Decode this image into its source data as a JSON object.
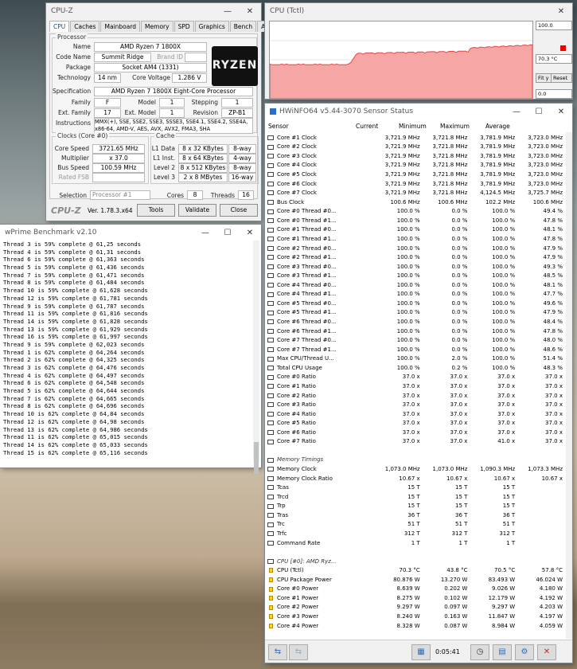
{
  "cpuz": {
    "title": "CPU-Z",
    "tabs": [
      "CPU",
      "Caches",
      "Mainboard",
      "Memory",
      "SPD",
      "Graphics",
      "Bench",
      "About"
    ],
    "processor_group": "Processor",
    "name_label": "Name",
    "name": "AMD Ryzen 7 1800X",
    "codename_label": "Code Name",
    "codename": "Summit Ridge",
    "brandid_label": "Brand ID",
    "package_label": "Package",
    "package": "Socket AM4 (1331)",
    "technology_label": "Technology",
    "technology": "14 nm",
    "voltage_label": "Core Voltage",
    "voltage": "1.286 V",
    "spec_label": "Specification",
    "spec": "AMD Ryzen 7 1800X Eight-Core Processor",
    "family_label": "Family",
    "family": "F",
    "model_label": "Model",
    "model": "1",
    "stepping_label": "Stepping",
    "stepping": "1",
    "extfamily_label": "Ext. Family",
    "extfamily": "17",
    "extmodel_label": "Ext. Model",
    "extmodel": "1",
    "revision_label": "Revision",
    "revision": "ZP-B1",
    "instructions_label": "Instructions",
    "instructions": "MMX(+), SSE, SSE2, SSE3, SSSE3, SSE4.1, SSE4.2, SSE4A, x86-64, AMD-V, AES, AVX, AVX2, FMA3, SHA",
    "clocks_group": "Clocks (Core #0)",
    "cache_group": "Cache",
    "corespeed_label": "Core Speed",
    "corespeed": "3721.65 MHz",
    "multiplier_label": "Multiplier",
    "multiplier": "x 37.0",
    "busspeed_label": "Bus Speed",
    "busspeed": "100.59 MHz",
    "ratedfsb_label": "Rated FSB",
    "l1d_label": "L1 Data",
    "l1d": "8 x 32 KBytes",
    "l1d_way": "8-way",
    "l1i_label": "L1 Inst.",
    "l1i": "8 x 64 KBytes",
    "l1i_way": "4-way",
    "l2_label": "Level 2",
    "l2": "8 x 512 KBytes",
    "l2_way": "8-way",
    "l3_label": "Level 3",
    "l3": "2 x 8 MBytes",
    "l3_way": "16-way",
    "selection_label": "Selection",
    "selection": "Processor #1",
    "cores_label": "Cores",
    "cores": "8",
    "threads_label": "Threads",
    "threads": "16",
    "brand": "CPU-Z",
    "version": "Ver. 1.78.3.x64",
    "tools": "Tools",
    "validate": "Validate",
    "close": "Close",
    "logo_text": "RYZEN"
  },
  "graph": {
    "title": "CPU (Tctl)",
    "top": "100.0",
    "current": "70.3 °C",
    "bottom": "0.0",
    "fit": "Fit y",
    "reset": "Reset",
    "line_color": "#e84545"
  },
  "wprime": {
    "title": "wPrime Benchmark v2.10",
    "lines": [
      "Thread 3 is 59% complete @ 61,25 seconds",
      "Thread 4 is 59% complete @ 61,31 seconds",
      "Thread 6 is 59% complete @ 61,363 seconds",
      "Thread 5 is 59% complete @ 61,436 seconds",
      "Thread 7 is 59% complete @ 61,471 seconds",
      "Thread 8 is 59% complete @ 61,484 seconds",
      "Thread 10 is 59% complete @ 61,628 seconds",
      "Thread 12 is 59% complete @ 61,781 seconds",
      "Thread 9 is 59% complete @ 61,787 seconds",
      "Thread 11 is 59% complete @ 61,816 seconds",
      "Thread 14 is 59% complete @ 61,828 seconds",
      "Thread 13 is 59% complete @ 61,929 seconds",
      "Thread 16 is 59% complete @ 61,997 seconds",
      "Thread 9 is 59% complete @ 62,023 seconds",
      "Thread 1 is 62% complete @ 64,264 seconds",
      "Thread 2 is 62% complete @ 64,325 seconds",
      "Thread 3 is 62% complete @ 64,476 seconds",
      "Thread 4 is 62% complete @ 64,497 seconds",
      "Thread 6 is 62% complete @ 64,548 seconds",
      "Thread 5 is 62% complete @ 64,644 seconds",
      "Thread 7 is 62% complete @ 64,665 seconds",
      "Thread 8 is 62% complete @ 64,696 seconds",
      "Thread 10 is 62% complete @ 64,84 seconds",
      "Thread 12 is 62% complete @ 64,98 seconds",
      "Thread 13 is 62% complete @ 64,986 seconds",
      "Thread 11 is 62% complete @ 65,015 seconds",
      "Thread 14 is 62% complete @ 65,033 seconds",
      "Thread 15 is 62% complete @ 65,116 seconds"
    ]
  },
  "hw": {
    "title": "HWiNFO64 v5.44-3070 Sensor Status",
    "cols": [
      "Sensor",
      "Current",
      "Minimum",
      "Maximum",
      "Average"
    ],
    "rows": [
      {
        "t": "c",
        "n": "Core #1 Clock",
        "v": [
          "3,721.9 MHz",
          "3,721.8 MHz",
          "3,781.9 MHz",
          "3,723.0 MHz"
        ]
      },
      {
        "t": "c",
        "n": "Core #2 Clock",
        "v": [
          "3,721.9 MHz",
          "3,721.8 MHz",
          "3,781.9 MHz",
          "3,723.0 MHz"
        ]
      },
      {
        "t": "c",
        "n": "Core #3 Clock",
        "v": [
          "3,721.9 MHz",
          "3,721.8 MHz",
          "3,781.9 MHz",
          "3,723.0 MHz"
        ]
      },
      {
        "t": "c",
        "n": "Core #4 Clock",
        "v": [
          "3,721.9 MHz",
          "3,721.8 MHz",
          "3,781.9 MHz",
          "3,723.0 MHz"
        ]
      },
      {
        "t": "c",
        "n": "Core #5 Clock",
        "v": [
          "3,721.9 MHz",
          "3,721.8 MHz",
          "3,781.9 MHz",
          "3,723.0 MHz"
        ]
      },
      {
        "t": "c",
        "n": "Core #6 Clock",
        "v": [
          "3,721.9 MHz",
          "3,721.8 MHz",
          "3,781.9 MHz",
          "3,723.0 MHz"
        ]
      },
      {
        "t": "c",
        "n": "Core #7 Clock",
        "v": [
          "3,721.9 MHz",
          "3,721.8 MHz",
          "4,124.5 MHz",
          "3,725.7 MHz"
        ]
      },
      {
        "t": "c",
        "n": "Bus Clock",
        "v": [
          "100.6 MHz",
          "100.6 MHz",
          "102.2 MHz",
          "100.6 MHz"
        ]
      },
      {
        "t": "c",
        "n": "Core #0 Thread #0...",
        "v": [
          "100.0 %",
          "0.0 %",
          "100.0 %",
          "49.4 %"
        ]
      },
      {
        "t": "c",
        "n": "Core #0 Thread #1...",
        "v": [
          "100.0 %",
          "0.0 %",
          "100.0 %",
          "47.8 %"
        ]
      },
      {
        "t": "c",
        "n": "Core #1 Thread #0...",
        "v": [
          "100.0 %",
          "0.0 %",
          "100.0 %",
          "48.1 %"
        ]
      },
      {
        "t": "c",
        "n": "Core #1 Thread #1...",
        "v": [
          "100.0 %",
          "0.0 %",
          "100.0 %",
          "47.8 %"
        ]
      },
      {
        "t": "c",
        "n": "Core #2 Thread #0...",
        "v": [
          "100.0 %",
          "0.0 %",
          "100.0 %",
          "47.9 %"
        ]
      },
      {
        "t": "c",
        "n": "Core #2 Thread #1...",
        "v": [
          "100.0 %",
          "0.0 %",
          "100.0 %",
          "47.9 %"
        ]
      },
      {
        "t": "c",
        "n": "Core #3 Thread #0...",
        "v": [
          "100.0 %",
          "0.0 %",
          "100.0 %",
          "49.3 %"
        ]
      },
      {
        "t": "c",
        "n": "Core #3 Thread #1...",
        "v": [
          "100.0 %",
          "0.0 %",
          "100.0 %",
          "48.5 %"
        ]
      },
      {
        "t": "c",
        "n": "Core #4 Thread #0...",
        "v": [
          "100.0 %",
          "0.0 %",
          "100.0 %",
          "48.1 %"
        ]
      },
      {
        "t": "c",
        "n": "Core #4 Thread #1...",
        "v": [
          "100.0 %",
          "0.0 %",
          "100.0 %",
          "47.7 %"
        ]
      },
      {
        "t": "c",
        "n": "Core #5 Thread #0...",
        "v": [
          "100.0 %",
          "0.0 %",
          "100.0 %",
          "49.6 %"
        ]
      },
      {
        "t": "c",
        "n": "Core #5 Thread #1...",
        "v": [
          "100.0 %",
          "0.0 %",
          "100.0 %",
          "47.9 %"
        ]
      },
      {
        "t": "c",
        "n": "Core #6 Thread #0...",
        "v": [
          "100.0 %",
          "0.0 %",
          "100.0 %",
          "48.4 %"
        ]
      },
      {
        "t": "c",
        "n": "Core #6 Thread #1...",
        "v": [
          "100.0 %",
          "0.0 %",
          "100.0 %",
          "47.8 %"
        ]
      },
      {
        "t": "c",
        "n": "Core #7 Thread #0...",
        "v": [
          "100.0 %",
          "0.0 %",
          "100.0 %",
          "48.0 %"
        ]
      },
      {
        "t": "c",
        "n": "Core #7 Thread #1...",
        "v": [
          "100.0 %",
          "0.0 %",
          "100.0 %",
          "48.6 %"
        ]
      },
      {
        "t": "c",
        "n": "Max CPU/Thread U...",
        "v": [
          "100.0 %",
          "2.0 %",
          "100.0 %",
          "51.4 %"
        ]
      },
      {
        "t": "c",
        "n": "Total CPU Usage",
        "v": [
          "100.0 %",
          "0.2 %",
          "100.0 %",
          "48.3 %"
        ]
      },
      {
        "t": "c",
        "n": "Core #0 Ratio",
        "v": [
          "37.0 x",
          "37.0 x",
          "37.0 x",
          "37.0 x"
        ]
      },
      {
        "t": "c",
        "n": "Core #1 Ratio",
        "v": [
          "37.0 x",
          "37.0 x",
          "37.0 x",
          "37.0 x"
        ]
      },
      {
        "t": "c",
        "n": "Core #2 Ratio",
        "v": [
          "37.0 x",
          "37.0 x",
          "37.0 x",
          "37.0 x"
        ]
      },
      {
        "t": "c",
        "n": "Core #3 Ratio",
        "v": [
          "37.0 x",
          "37.0 x",
          "37.0 x",
          "37.0 x"
        ]
      },
      {
        "t": "c",
        "n": "Core #4 Ratio",
        "v": [
          "37.0 x",
          "37.0 x",
          "37.0 x",
          "37.0 x"
        ]
      },
      {
        "t": "c",
        "n": "Core #5 Ratio",
        "v": [
          "37.0 x",
          "37.0 x",
          "37.0 x",
          "37.0 x"
        ]
      },
      {
        "t": "c",
        "n": "Core #6 Ratio",
        "v": [
          "37.0 x",
          "37.0 x",
          "37.0 x",
          "37.0 x"
        ]
      },
      {
        "t": "c",
        "n": "Core #7 Ratio",
        "v": [
          "37.0 x",
          "37.0 x",
          "41.0 x",
          "37.0 x"
        ]
      },
      {
        "t": "b",
        "n": "",
        "v": [
          "",
          "",
          "",
          ""
        ]
      },
      {
        "t": "s",
        "n": "Memory Timings",
        "v": [
          "",
          "",
          "",
          ""
        ]
      },
      {
        "t": "c",
        "n": "Memory Clock",
        "v": [
          "1,073.0 MHz",
          "1,073.0 MHz",
          "1,090.3 MHz",
          "1,073.3 MHz"
        ]
      },
      {
        "t": "c",
        "n": "Memory Clock Ratio",
        "v": [
          "10.67 x",
          "10.67 x",
          "10.67 x",
          "10.67 x"
        ]
      },
      {
        "t": "c",
        "n": "Tcas",
        "v": [
          "15 T",
          "15 T",
          "15 T",
          ""
        ]
      },
      {
        "t": "c",
        "n": "Trcd",
        "v": [
          "15 T",
          "15 T",
          "15 T",
          ""
        ]
      },
      {
        "t": "c",
        "n": "Trp",
        "v": [
          "15 T",
          "15 T",
          "15 T",
          ""
        ]
      },
      {
        "t": "c",
        "n": "Tras",
        "v": [
          "36 T",
          "36 T",
          "36 T",
          ""
        ]
      },
      {
        "t": "c",
        "n": "Trc",
        "v": [
          "51 T",
          "51 T",
          "51 T",
          ""
        ]
      },
      {
        "t": "c",
        "n": "Trfc",
        "v": [
          "312 T",
          "312 T",
          "312 T",
          ""
        ]
      },
      {
        "t": "c",
        "n": "Command Rate",
        "v": [
          "1 T",
          "1 T",
          "1 T",
          ""
        ]
      },
      {
        "t": "b",
        "n": "",
        "v": [
          "",
          "",
          "",
          ""
        ]
      },
      {
        "t": "s",
        "n": "CPU [#0]: AMD Ryz...",
        "v": [
          "",
          "",
          "",
          ""
        ]
      },
      {
        "t": "y",
        "n": "CPU (Tctl)",
        "v": [
          "70.3 °C",
          "43.8 °C",
          "70.5 °C",
          "57.8 °C"
        ]
      },
      {
        "t": "y",
        "n": "CPU Package Power",
        "v": [
          "80.876 W",
          "13.270 W",
          "83.493 W",
          "46.024 W"
        ]
      },
      {
        "t": "y",
        "n": "Core #0 Power",
        "v": [
          "8.639 W",
          "0.202 W",
          "9.026 W",
          "4.180 W"
        ]
      },
      {
        "t": "y",
        "n": "Core #1 Power",
        "v": [
          "8.275 W",
          "0.102 W",
          "12.179 W",
          "4.192 W"
        ]
      },
      {
        "t": "y",
        "n": "Core #2 Power",
        "v": [
          "9.297 W",
          "0.097 W",
          "9.297 W",
          "4.203 W"
        ]
      },
      {
        "t": "y",
        "n": "Core #3 Power",
        "v": [
          "8.240 W",
          "0.163 W",
          "11.847 W",
          "4.197 W"
        ]
      },
      {
        "t": "y",
        "n": "Core #4 Power",
        "v": [
          "8.328 W",
          "0.087 W",
          "8.984 W",
          "4.059 W"
        ]
      }
    ],
    "timer": "0:05:41"
  }
}
